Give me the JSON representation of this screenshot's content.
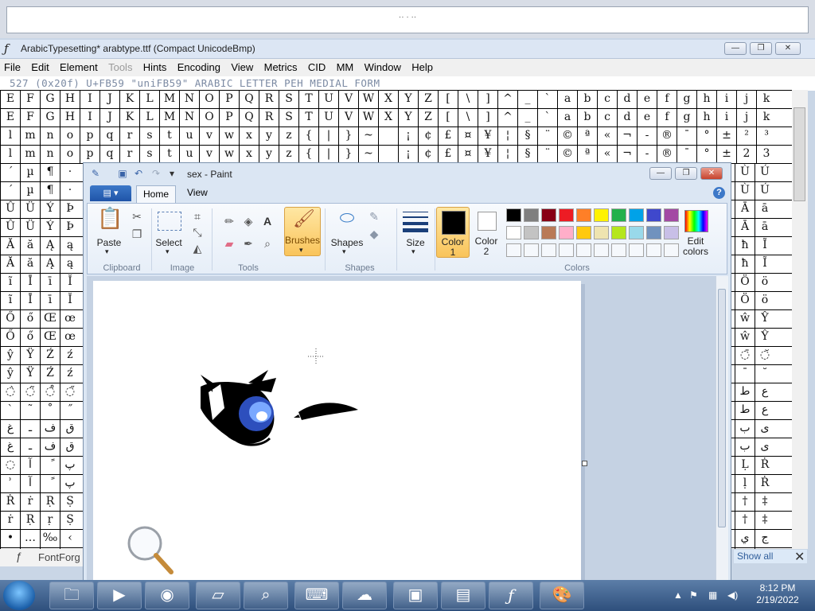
{
  "top_strip": {
    "hint": "·· · ··"
  },
  "fontforge": {
    "title": "ArabicTypesetting*  arabtype.ttf (Compact UnicodeBmp)",
    "menu": [
      "File",
      "Edit",
      "Element",
      "Tools",
      "Hints",
      "Encoding",
      "View",
      "Metrics",
      "CID",
      "MM",
      "Window",
      "Help"
    ],
    "info": "527  (0x20f)  U+FB59  \"uniFB59\"  ARABIC LETTER PEH MEDIAL FORM",
    "grid_rows": [
      [
        "E",
        "F",
        "G",
        "H",
        "I",
        "J",
        "K",
        "L",
        "M",
        "N",
        "O",
        "P",
        "Q",
        "R",
        "S",
        "T",
        "U",
        "V",
        "W",
        "X",
        "Y",
        "Z",
        "[",
        "\\",
        "]",
        "^",
        "_",
        "`",
        "a",
        "b",
        "c",
        "d",
        "e",
        "f",
        "g",
        "h",
        "i",
        "j",
        "k"
      ],
      [
        "E",
        "F",
        "G",
        "H",
        "I",
        "J",
        "K",
        "L",
        "M",
        "N",
        "O",
        "P",
        "Q",
        "R",
        "S",
        "T",
        "U",
        "V",
        "W",
        "X",
        "Y",
        "Z",
        "[",
        "\\",
        "]",
        "^",
        "_",
        "`",
        "a",
        "b",
        "c",
        "d",
        "e",
        "f",
        "g",
        "h",
        "i",
        "j",
        "k"
      ],
      [
        "l",
        "m",
        "n",
        "o",
        "p",
        "q",
        "r",
        "s",
        "t",
        "u",
        "v",
        "w",
        "x",
        "y",
        "z",
        "{",
        "|",
        "}",
        "~",
        "",
        "¡",
        "¢",
        "£",
        "¤",
        "¥",
        "¦",
        "§",
        "¨",
        "©",
        "ª",
        "«",
        "¬",
        "-",
        "®",
        "¯",
        "°",
        "±",
        "²",
        "³"
      ],
      [
        "l",
        "m",
        "n",
        "o",
        "p",
        "q",
        "r",
        "s",
        "t",
        "u",
        "v",
        "w",
        "x",
        "y",
        "z",
        "{",
        "|",
        "}",
        "~",
        "",
        "¡",
        "¢",
        "£",
        "¤",
        "¥",
        "¦",
        "§",
        "¨",
        "©",
        "ª",
        "«",
        "¬",
        "-",
        "®",
        "¯",
        "°",
        "±",
        "2",
        "3"
      ]
    ],
    "left_rows": [
      [
        "´",
        "µ",
        "¶",
        "·"
      ],
      [
        "´",
        "µ",
        "¶",
        "·"
      ],
      [
        "Û",
        "Ü",
        "Ý",
        "Þ"
      ],
      [
        "Û",
        "Ü",
        "Ý",
        "Þ"
      ],
      [
        "Ă",
        "ă",
        "Ą",
        "ą"
      ],
      [
        "Ă",
        "ă",
        "Ą",
        "ą"
      ],
      [
        "ĩ",
        "Ī",
        "ī",
        "Ĭ"
      ],
      [
        "ĩ",
        "Ī",
        "ī",
        "Ĭ"
      ],
      [
        "Ő",
        "ő",
        "Œ",
        "œ"
      ],
      [
        "Ő",
        "ő",
        "Œ",
        "œ"
      ],
      [
        "ŷ",
        "Ÿ",
        "Ź",
        "ź"
      ],
      [
        "ŷ",
        "Ÿ",
        "Ź",
        "ź"
      ],
      [
        "◌̀",
        "◌̃",
        "◌̊",
        "◌̋"
      ],
      [
        "ˋ",
        "˜",
        "˚",
        "˝"
      ],
      [
        "غ",
        "ـ",
        "ف",
        "ق"
      ],
      [
        "غ",
        "ـ",
        "ف",
        "ق"
      ],
      [
        "◌",
        "آ",
        "ً",
        "پ"
      ],
      [
        "ʾ",
        "آ",
        "ً",
        "پ"
      ],
      [
        "Ṙ",
        "ṙ",
        "Ṛ",
        "Ṣ"
      ],
      [
        "ṙ",
        "Ṛ",
        "ṛ",
        "Ṣ"
      ],
      [
        "•",
        "…",
        "‰",
        "‹"
      ],
      [
        "•",
        "…",
        "‰",
        "‹"
      ]
    ],
    "right_rows": [
      [
        "Ù",
        "Ú"
      ],
      [
        "Ù",
        "Ú"
      ],
      [
        "Ā",
        "ā"
      ],
      [
        "Ā",
        "ā"
      ],
      [
        "ħ",
        "Ĩ"
      ],
      [
        "ħ",
        "Ĩ"
      ],
      [
        "Ö",
        "ö"
      ],
      [
        "Ö",
        "ö"
      ],
      [
        "ŵ",
        "Ŷ"
      ],
      [
        "ŵ",
        "Ŷ"
      ],
      [
        "◌̄",
        "◌̆"
      ],
      [
        "ˉ",
        "˘"
      ],
      [
        "ط",
        "ع"
      ],
      [
        "ط",
        "ع"
      ],
      [
        "ب",
        "ى"
      ],
      [
        "ب",
        "ى"
      ],
      [
        "Ḷ",
        "Ṙ"
      ],
      [
        "ḷ",
        "Ṙ"
      ],
      [
        "†",
        "‡"
      ],
      [
        "†",
        "‡"
      ],
      [
        "ي",
        "ج"
      ],
      [
        "ي",
        "ج"
      ]
    ],
    "status_label": "FontForg",
    "show_all": "Show all"
  },
  "paint": {
    "title": "sex - Paint",
    "tabs": {
      "home": "Home",
      "view": "View"
    },
    "groups": {
      "clipboard": "Clipboard",
      "image": "Image",
      "tools": "Tools",
      "shapes": "Shapes",
      "colors": "Colors"
    },
    "buttons": {
      "paste": "Paste",
      "select": "Select",
      "brushes": "Brushes",
      "shapes": "Shapes",
      "size": "Size",
      "color1": "Color",
      "color1_num": "1",
      "color2": "Color",
      "color2_num": "2",
      "edit": "Edit",
      "colors": "colors"
    },
    "palette_row1": [
      "#000000",
      "#7f7f7f",
      "#880015",
      "#ed1c24",
      "#ff7f27",
      "#fff200",
      "#22b14c",
      "#00a2e8",
      "#3f48cc",
      "#a349a4"
    ],
    "palette_row2": [
      "#ffffff",
      "#c3c3c3",
      "#b97a57",
      "#ffaec9",
      "#ffc90e",
      "#efe4b0",
      "#b5e61d",
      "#99d9ea",
      "#7092be",
      "#c8bfe7"
    ]
  },
  "taskbar": {
    "time": "8:12 PM",
    "date": "2/19/2022"
  }
}
